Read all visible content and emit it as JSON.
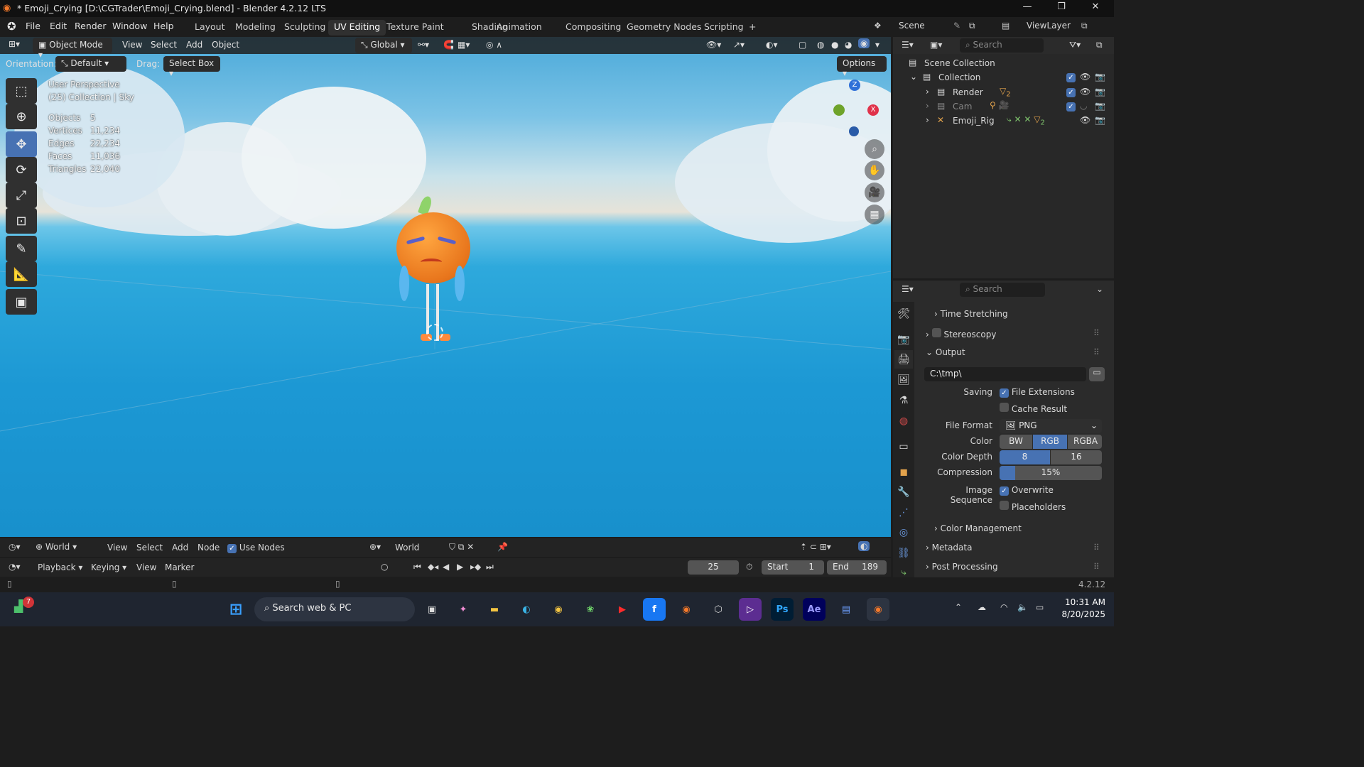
{
  "window": {
    "title": "* Emoji_Crying [D:\\CGTrader\\Emoji_Crying.blend] - Blender 4.2.12 LTS",
    "minimize": "—",
    "maximize": "❐",
    "close": "✕"
  },
  "menu": [
    "File",
    "Edit",
    "Render",
    "Window",
    "Help"
  ],
  "workspaces": [
    "Layout",
    "Modeling",
    "Sculpting",
    "UV Editing",
    "Texture Paint",
    "Shading",
    "Animation",
    "Compositing",
    "Geometry Nodes",
    "Scripting",
    "+"
  ],
  "active_workspace": "UV Editing",
  "scene": {
    "label": "Scene",
    "viewlayer": "ViewLayer"
  },
  "viewport_header": {
    "mode": "Object Mode",
    "menus": [
      "View",
      "Select",
      "Add",
      "Object"
    ],
    "transform": "Global"
  },
  "tool_settings": {
    "orientation_label": "Orientation:",
    "orientation_value": "Default",
    "drag_label": "Drag:",
    "drag_value": "Select Box",
    "options": "Options"
  },
  "overlay_text": {
    "perspective": "User Perspective",
    "collection": "(25) Collection | Sky"
  },
  "stats": [
    {
      "label": "Objects",
      "value": "5"
    },
    {
      "label": "Vertices",
      "value": "11,234"
    },
    {
      "label": "Edges",
      "value": "22,234"
    },
    {
      "label": "Faces",
      "value": "11,036"
    },
    {
      "label": "Triangles",
      "value": "22,040"
    }
  ],
  "gizmo_axes": {
    "z": "Z",
    "x": "X"
  },
  "outliner": {
    "search_placeholder": "Search",
    "root": "Scene Collection",
    "collection": "Collection",
    "items": [
      {
        "name": "Render",
        "badge": "2"
      },
      {
        "name": "Cam",
        "badge": ""
      },
      {
        "name": "Emoji_Rig",
        "badge": "2"
      }
    ]
  },
  "properties": {
    "search_placeholder": "Search",
    "panels": {
      "time_stretching": "Time Stretching",
      "stereoscopy": "Stereoscopy",
      "output": "Output",
      "color_management": "Color Management",
      "metadata": "Metadata",
      "post_processing": "Post Processing"
    },
    "output_path": "C:\\tmp\\",
    "saving_label": "Saving",
    "file_extensions": "File Extensions",
    "cache_result": "Cache Result",
    "file_format_label": "File Format",
    "file_format": "PNG",
    "color_label": "Color",
    "color_options": [
      "BW",
      "RGB",
      "RGBA"
    ],
    "color_selected": "RGB",
    "color_depth_label": "Color Depth",
    "color_depth_options": [
      "8",
      "16"
    ],
    "color_depth_selected": "8",
    "compression_label": "Compression",
    "compression": "15%",
    "compression_fraction": 0.15,
    "image_sequence_label": "Image Sequence",
    "overwrite": "Overwrite",
    "placeholders": "Placeholders"
  },
  "shader_header": {
    "world": "World",
    "menus": [
      "View",
      "Select",
      "Add",
      "Node"
    ],
    "use_nodes": "Use Nodes",
    "world_slot": "World"
  },
  "timeline": {
    "menus": [
      "Playback",
      "Keying",
      "View",
      "Marker"
    ],
    "current_frame": "25",
    "start_label": "Start",
    "start": "1",
    "end_label": "End",
    "end": "189"
  },
  "statusbar": {
    "version": "4.2.12"
  },
  "taskbar": {
    "search": "Search web & PC",
    "time": "10:31 AM",
    "date": "8/20/2025",
    "notif": "7"
  },
  "colors": {
    "accent": "#4772b3",
    "bg": "#1d1d1d",
    "panel": "#2b2b2b"
  }
}
